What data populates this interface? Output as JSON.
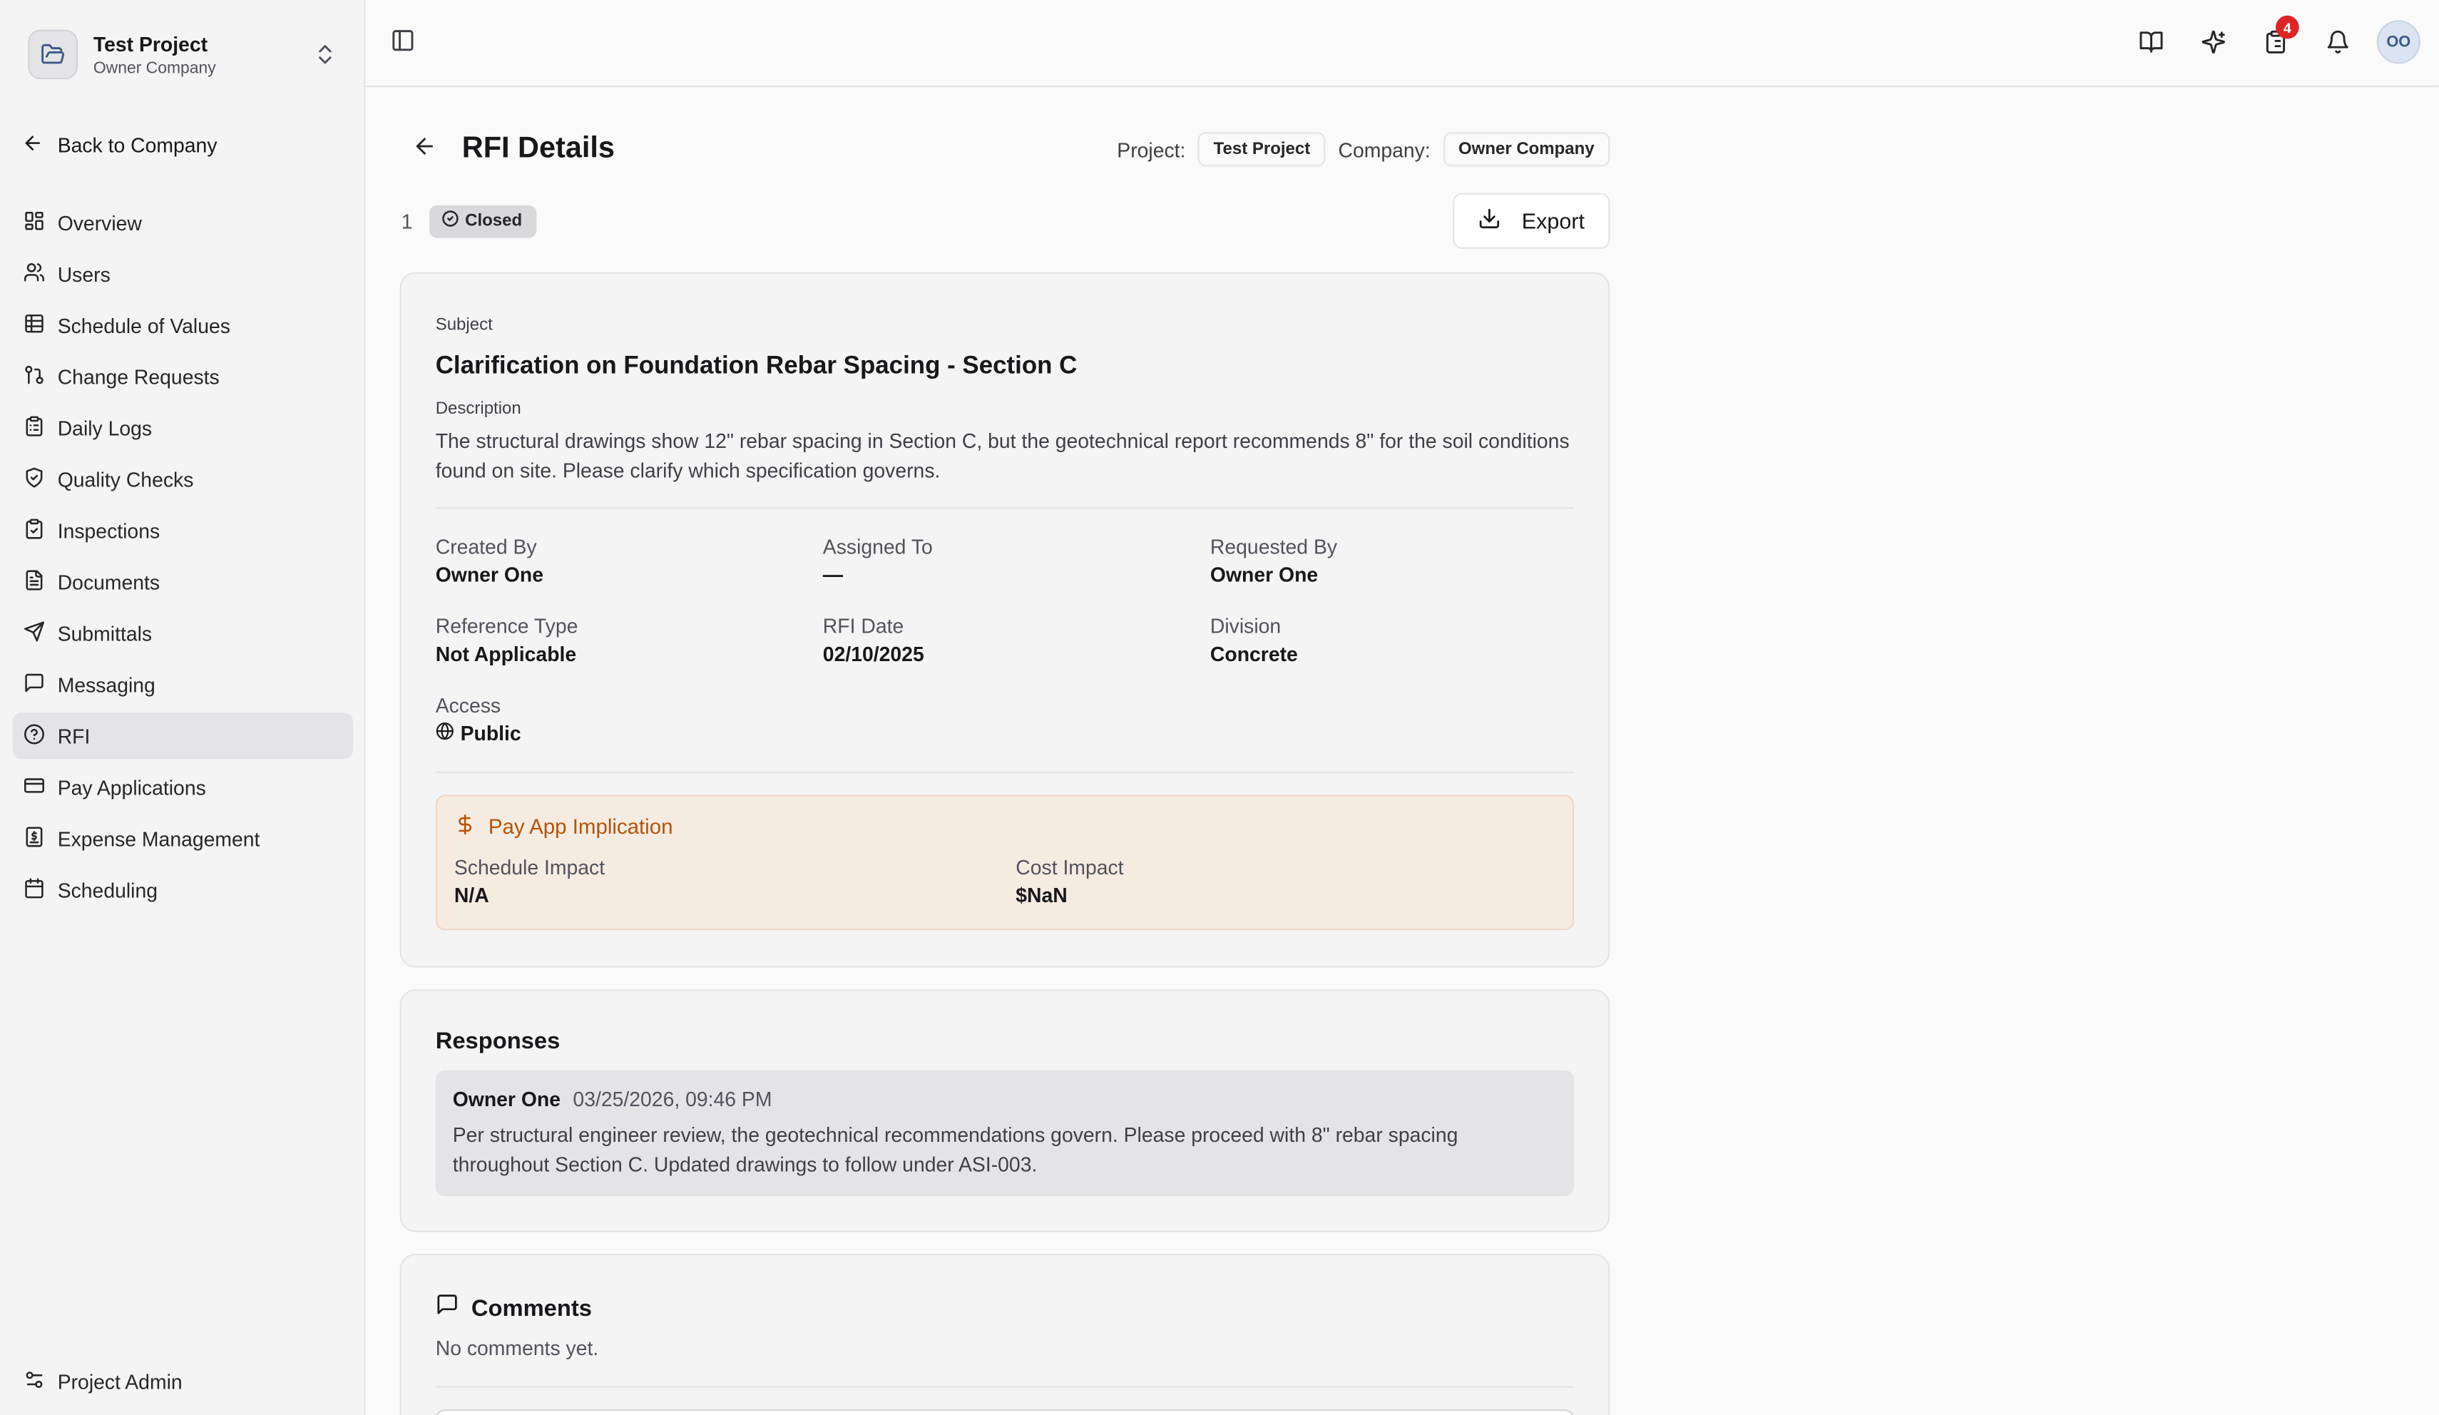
{
  "sidebar": {
    "project_name": "Test Project",
    "company_name": "Owner Company",
    "back_label": "Back to Company",
    "items": [
      {
        "label": "Overview",
        "icon": "layout-grid-icon"
      },
      {
        "label": "Users",
        "icon": "users-icon"
      },
      {
        "label": "Schedule of Values",
        "icon": "table-icon"
      },
      {
        "label": "Change Requests",
        "icon": "git-pull-request-icon"
      },
      {
        "label": "Daily Logs",
        "icon": "clipboard-icon"
      },
      {
        "label": "Quality Checks",
        "icon": "shield-check-icon"
      },
      {
        "label": "Inspections",
        "icon": "clipboard-check-icon"
      },
      {
        "label": "Documents",
        "icon": "file-text-icon"
      },
      {
        "label": "Submittals",
        "icon": "send-icon"
      },
      {
        "label": "Messaging",
        "icon": "message-square-icon"
      },
      {
        "label": "RFI",
        "icon": "help-circle-icon",
        "active": true
      },
      {
        "label": "Pay Applications",
        "icon": "credit-card-icon"
      },
      {
        "label": "Expense Management",
        "icon": "receipt-icon"
      },
      {
        "label": "Scheduling",
        "icon": "calendar-icon"
      }
    ],
    "admin_label": "Project Admin"
  },
  "topbar": {
    "notification_count": "4",
    "avatar_initials": "OO"
  },
  "header": {
    "title": "RFI Details",
    "project_label": "Project:",
    "project_value": "Test Project",
    "company_label": "Company:",
    "company_value": "Owner Company",
    "rfi_number": "1",
    "status": "Closed",
    "export_label": "Export"
  },
  "details": {
    "subject_label": "Subject",
    "subject": "Clarification on Foundation Rebar Spacing - Section C",
    "description_label": "Description",
    "description": "The structural drawings show 12\" rebar spacing in Section C, but the geotechnical report recommends 8\" for the soil conditions found on site. Please clarify which specification governs.",
    "fields": {
      "created_by_label": "Created By",
      "created_by": "Owner One",
      "assigned_to_label": "Assigned To",
      "assigned_to": "—",
      "requested_by_label": "Requested By",
      "requested_by": "Owner One",
      "reference_type_label": "Reference Type",
      "reference_type": "Not Applicable",
      "rfi_date_label": "RFI Date",
      "rfi_date": "02/10/2025",
      "division_label": "Division",
      "division": "Concrete",
      "access_label": "Access",
      "access": "Public"
    },
    "pay_app": {
      "title": "Pay App Implication",
      "schedule_impact_label": "Schedule Impact",
      "schedule_impact": "N/A",
      "cost_impact_label": "Cost Impact",
      "cost_impact": "$NaN"
    }
  },
  "responses": {
    "title": "Responses",
    "items": [
      {
        "author": "Owner One",
        "date": "03/25/2026, 09:46 PM",
        "text": "Per structural engineer review, the geotechnical recommendations govern. Please proceed with 8\" rebar spacing throughout Section C. Updated drawings to follow under ASI-003."
      }
    ]
  },
  "comments": {
    "title": "Comments",
    "empty_text": "No comments yet."
  },
  "colors": {
    "accent_warning": "#b45309",
    "badge_red": "#dc2626",
    "active_nav": "#e4e4e7"
  }
}
